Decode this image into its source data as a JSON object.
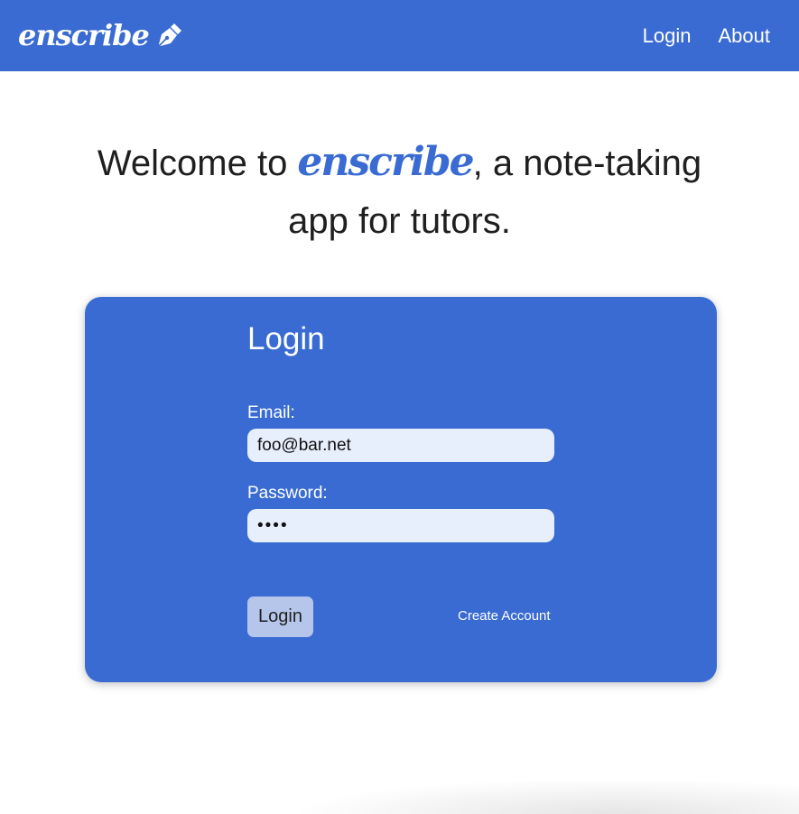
{
  "navbar": {
    "brand": "enscribe",
    "brand_icon": "pen-nib-icon",
    "links": [
      "Login",
      "About"
    ],
    "color": "#396bd3"
  },
  "hero": {
    "prefix": "Welcome to ",
    "brand": "enscribe",
    "suffix": ", a note-taking app for tutors."
  },
  "login_form": {
    "title": "Login",
    "email_label": "Email:",
    "email_value": "foo@bar.net",
    "password_label": "Password:",
    "password_value": "••••",
    "submit_label": "Login",
    "create_account_label": "Create Account",
    "card_color": "#396bd3",
    "input_color": "#e8effc",
    "button_color": "#b6c6ea"
  }
}
